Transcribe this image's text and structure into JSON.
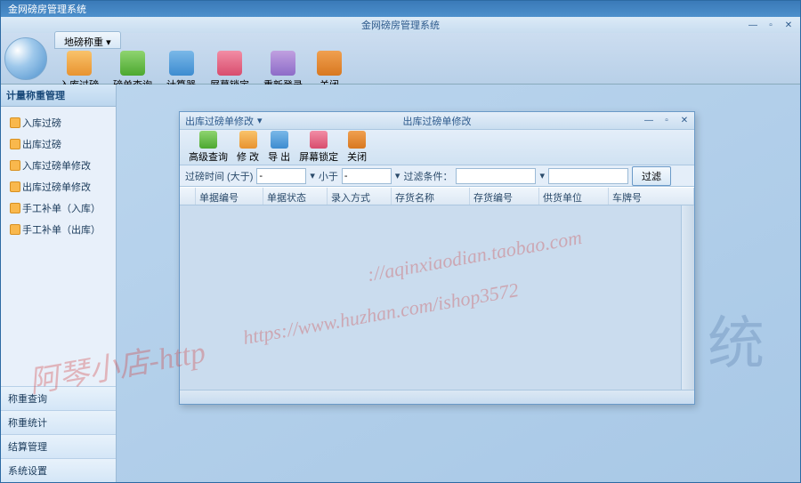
{
  "app": {
    "title": "金网磅房管理系统"
  },
  "ribbon": {
    "tab": "地磅称重",
    "buttons": [
      {
        "label": "入库过磅",
        "icon": "ic1"
      },
      {
        "label": "磅单查询",
        "icon": "ic2"
      },
      {
        "label": "计算器",
        "icon": "ic3"
      },
      {
        "label": "屏幕锁定",
        "icon": "ic4"
      },
      {
        "label": "重新登录",
        "icon": "ic5"
      },
      {
        "label": "关闭",
        "icon": "ic6"
      }
    ]
  },
  "inner_title": "金网磅房管理系统",
  "sidebar": {
    "header": "计量称重管理",
    "items": [
      {
        "label": "入库过磅"
      },
      {
        "label": "出库过磅"
      },
      {
        "label": "入库过磅单修改"
      },
      {
        "label": "出库过磅单修改"
      },
      {
        "label": "手工补单（入库）"
      },
      {
        "label": "手工补单（出库）"
      }
    ],
    "bottom": [
      {
        "label": "称重查询"
      },
      {
        "label": "称重统计"
      },
      {
        "label": "结算管理"
      },
      {
        "label": "系统设置"
      }
    ]
  },
  "subwin": {
    "tab": "出库过磅单修改",
    "title": "出库过磅单修改",
    "toolbar": [
      {
        "label": "高级查询",
        "icon": "ic2"
      },
      {
        "label": "修 改",
        "icon": "ic1"
      },
      {
        "label": "导 出",
        "icon": "ic3"
      },
      {
        "label": "屏幕锁定",
        "icon": "ic4"
      },
      {
        "label": "关闭",
        "icon": "ic6"
      }
    ],
    "filter": {
      "time_gt": "过磅时间 (大于)",
      "time_lt": "小于",
      "cond": "过滤条件：",
      "btn": "过滤"
    },
    "columns": [
      "",
      "单据编号",
      "单据状态",
      "录入方式",
      "存货名称",
      "存货编号",
      "供货单位",
      "车牌号"
    ]
  },
  "bg_text": "系 统",
  "watermarks": {
    "w1": "阿琴小店-http",
    "w2": "https://www.huzhan.com/ishop3572",
    "w3": "://aqinxiaodian.taobao.com"
  }
}
